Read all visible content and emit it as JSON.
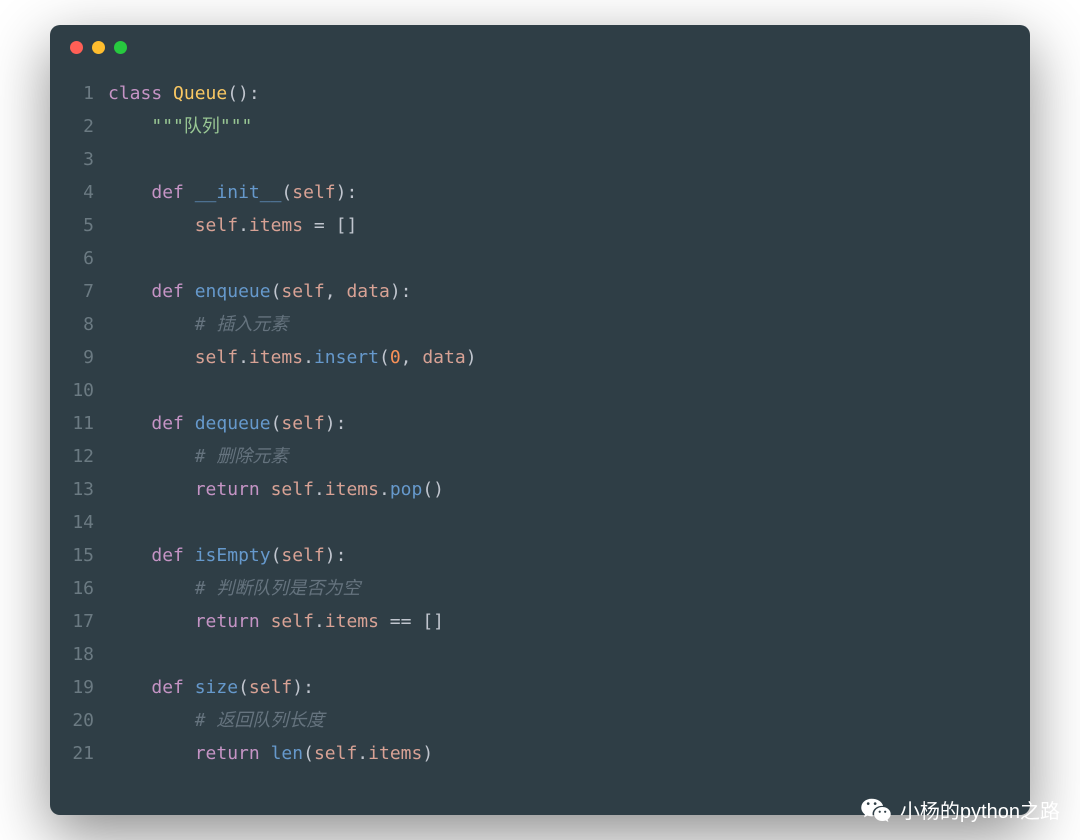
{
  "window": {
    "traffic_lights": [
      "close",
      "minimize",
      "zoom"
    ]
  },
  "code": {
    "lines": [
      {
        "n": 1,
        "tokens": [
          [
            "kw",
            "class"
          ],
          [
            "op",
            " "
          ],
          [
            "cls",
            "Queue"
          ],
          [
            "op",
            "():"
          ]
        ]
      },
      {
        "n": 2,
        "tokens": [
          [
            "op",
            "    "
          ],
          [
            "str",
            "\"\"\"队列\"\"\""
          ]
        ]
      },
      {
        "n": 3,
        "tokens": []
      },
      {
        "n": 4,
        "tokens": [
          [
            "op",
            "    "
          ],
          [
            "kw",
            "def"
          ],
          [
            "op",
            " "
          ],
          [
            "fn",
            "__init__"
          ],
          [
            "op",
            "("
          ],
          [
            "self",
            "self"
          ],
          [
            "op",
            "):"
          ]
        ]
      },
      {
        "n": 5,
        "tokens": [
          [
            "op",
            "        "
          ],
          [
            "self",
            "self"
          ],
          [
            "op",
            "."
          ],
          [
            "attr",
            "items"
          ],
          [
            "op",
            " = []"
          ]
        ]
      },
      {
        "n": 6,
        "tokens": []
      },
      {
        "n": 7,
        "tokens": [
          [
            "op",
            "    "
          ],
          [
            "kw",
            "def"
          ],
          [
            "op",
            " "
          ],
          [
            "fn",
            "enqueue"
          ],
          [
            "op",
            "("
          ],
          [
            "self",
            "self"
          ],
          [
            "op",
            ", "
          ],
          [
            "attr",
            "data"
          ],
          [
            "op",
            "):"
          ]
        ]
      },
      {
        "n": 8,
        "tokens": [
          [
            "op",
            "        "
          ],
          [
            "cmt",
            "# 插入元素"
          ]
        ]
      },
      {
        "n": 9,
        "tokens": [
          [
            "op",
            "        "
          ],
          [
            "self",
            "self"
          ],
          [
            "op",
            "."
          ],
          [
            "attr",
            "items"
          ],
          [
            "op",
            "."
          ],
          [
            "meth",
            "insert"
          ],
          [
            "op",
            "("
          ],
          [
            "num",
            "0"
          ],
          [
            "op",
            ", "
          ],
          [
            "attr",
            "data"
          ],
          [
            "op",
            ")"
          ]
        ]
      },
      {
        "n": 10,
        "tokens": []
      },
      {
        "n": 11,
        "tokens": [
          [
            "op",
            "    "
          ],
          [
            "kw",
            "def"
          ],
          [
            "op",
            " "
          ],
          [
            "fn",
            "dequeue"
          ],
          [
            "op",
            "("
          ],
          [
            "self",
            "self"
          ],
          [
            "op",
            "):"
          ]
        ]
      },
      {
        "n": 12,
        "tokens": [
          [
            "op",
            "        "
          ],
          [
            "cmt",
            "# 删除元素"
          ]
        ]
      },
      {
        "n": 13,
        "tokens": [
          [
            "op",
            "        "
          ],
          [
            "kw",
            "return"
          ],
          [
            "op",
            " "
          ],
          [
            "self",
            "self"
          ],
          [
            "op",
            "."
          ],
          [
            "attr",
            "items"
          ],
          [
            "op",
            "."
          ],
          [
            "meth",
            "pop"
          ],
          [
            "op",
            "()"
          ]
        ]
      },
      {
        "n": 14,
        "tokens": []
      },
      {
        "n": 15,
        "tokens": [
          [
            "op",
            "    "
          ],
          [
            "kw",
            "def"
          ],
          [
            "op",
            " "
          ],
          [
            "fn",
            "isEmpty"
          ],
          [
            "op",
            "("
          ],
          [
            "self",
            "self"
          ],
          [
            "op",
            "):"
          ]
        ]
      },
      {
        "n": 16,
        "tokens": [
          [
            "op",
            "        "
          ],
          [
            "cmt",
            "# 判断队列是否为空"
          ]
        ]
      },
      {
        "n": 17,
        "tokens": [
          [
            "op",
            "        "
          ],
          [
            "kw",
            "return"
          ],
          [
            "op",
            " "
          ],
          [
            "self",
            "self"
          ],
          [
            "op",
            "."
          ],
          [
            "attr",
            "items"
          ],
          [
            "op",
            " == []"
          ]
        ]
      },
      {
        "n": 18,
        "tokens": []
      },
      {
        "n": 19,
        "tokens": [
          [
            "op",
            "    "
          ],
          [
            "kw",
            "def"
          ],
          [
            "op",
            " "
          ],
          [
            "fn",
            "size"
          ],
          [
            "op",
            "("
          ],
          [
            "self",
            "self"
          ],
          [
            "op",
            "):"
          ]
        ]
      },
      {
        "n": 20,
        "tokens": [
          [
            "op",
            "        "
          ],
          [
            "cmt",
            "# 返回队列长度"
          ]
        ]
      },
      {
        "n": 21,
        "tokens": [
          [
            "op",
            "        "
          ],
          [
            "kw",
            "return"
          ],
          [
            "op",
            " "
          ],
          [
            "meth",
            "len"
          ],
          [
            "op",
            "("
          ],
          [
            "self",
            "self"
          ],
          [
            "op",
            "."
          ],
          [
            "attr",
            "items"
          ],
          [
            "op",
            ")"
          ]
        ]
      }
    ]
  },
  "watermark": {
    "text": "小杨的python之路",
    "icon": "wechat-icon"
  }
}
